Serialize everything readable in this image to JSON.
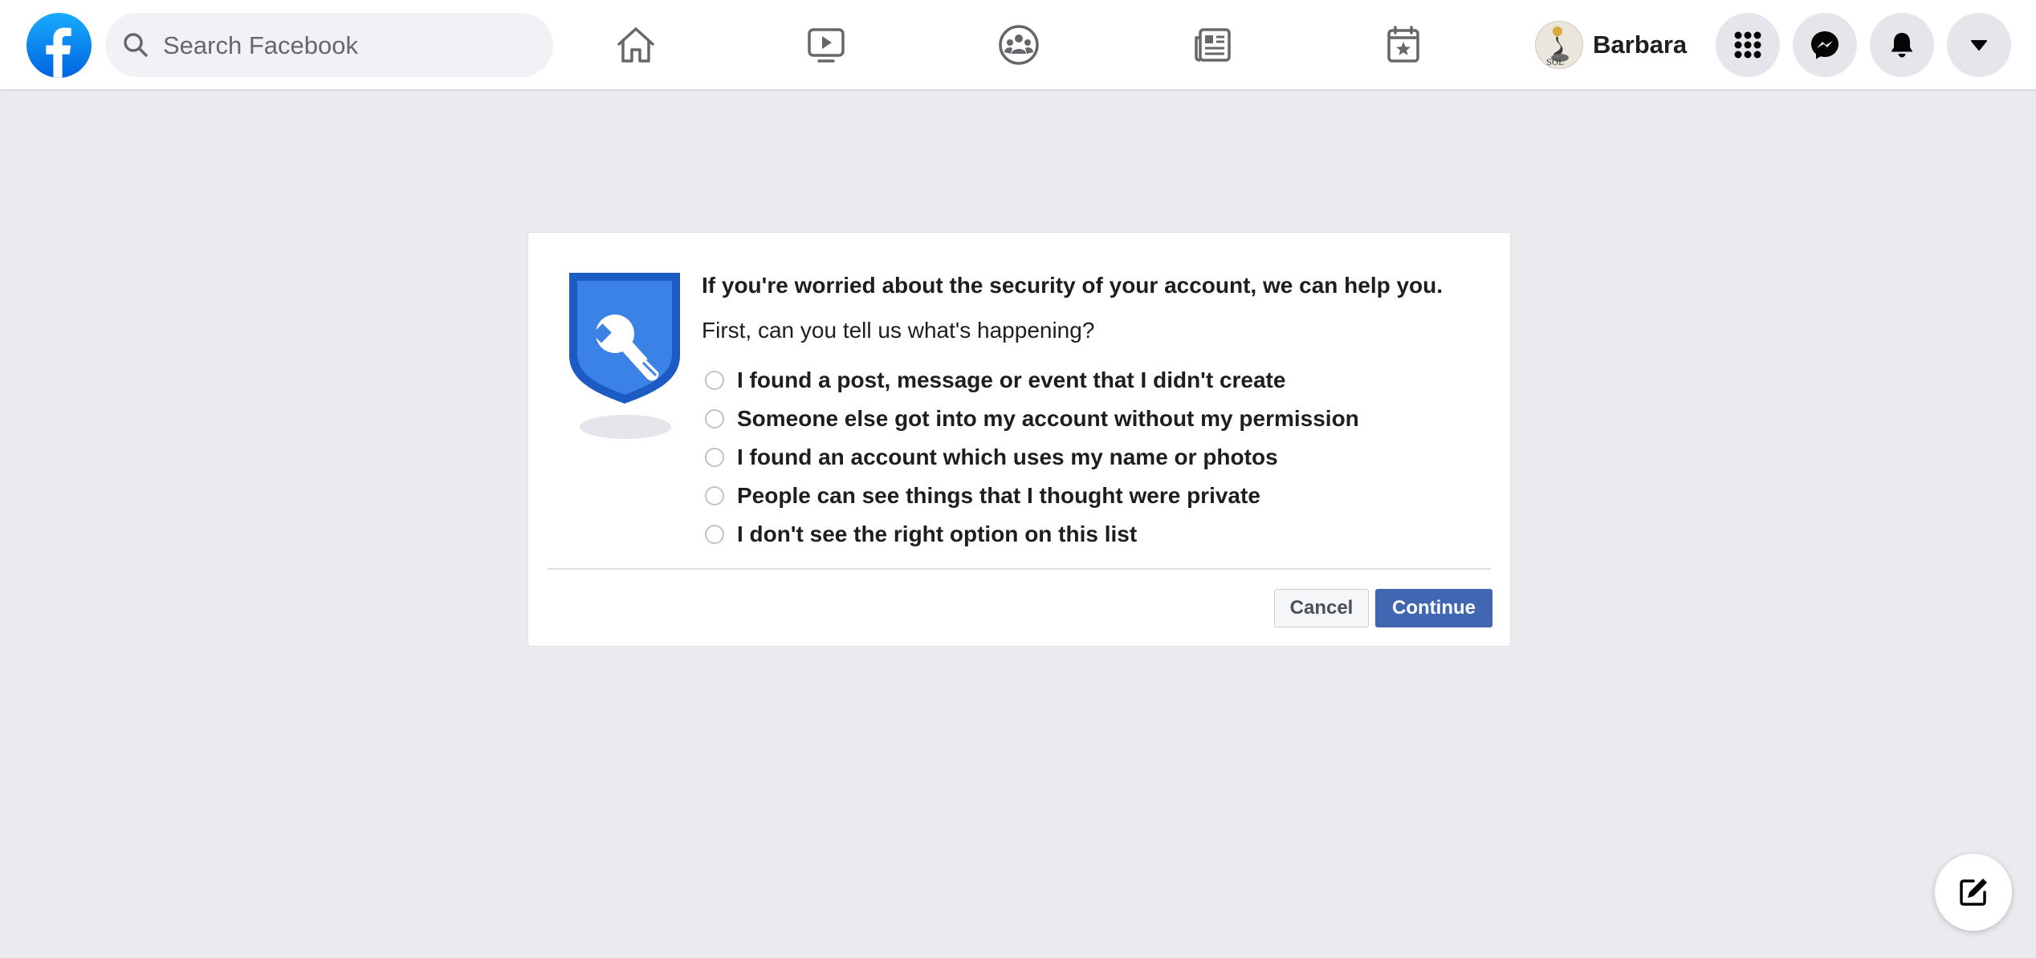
{
  "header": {
    "logo_icon": "facebook-logo-icon",
    "search": {
      "placeholder": "Search Facebook",
      "icon": "search-icon"
    },
    "nav_tabs": [
      {
        "name": "home",
        "icon": "home-icon"
      },
      {
        "name": "watch",
        "icon": "video-play-icon"
      },
      {
        "name": "groups",
        "icon": "groups-icon"
      },
      {
        "name": "news",
        "icon": "newspaper-icon"
      },
      {
        "name": "pages",
        "icon": "calendar-star-icon"
      }
    ],
    "profile": {
      "name": "Barbara",
      "icon": "avatar"
    },
    "action_buttons": [
      {
        "name": "menu",
        "icon": "grid-menu-icon"
      },
      {
        "name": "messenger",
        "icon": "messenger-icon"
      },
      {
        "name": "notifications",
        "icon": "bell-icon"
      },
      {
        "name": "account",
        "icon": "caret-down-icon"
      }
    ]
  },
  "dialog": {
    "icon": "security-shield-wrench-icon",
    "heading": "If you're worried about the security of your account, we can help you.",
    "subheading": "First, can you tell us what's happening?",
    "options": [
      "I found a post, message or event that I didn't create",
      "Someone else got into my account without my permission",
      "I found an account which uses my name or photos",
      "People can see things that I thought were private",
      "I don't see the right option on this list"
    ],
    "cancel_label": "Cancel",
    "continue_label": "Continue"
  },
  "compose": {
    "icon": "compose-icon"
  },
  "colors": {
    "brand_blue": "#1877f2",
    "button_blue": "#4267b2",
    "page_background": "#e9ebee",
    "shield_blue": "#2e6fd9"
  }
}
